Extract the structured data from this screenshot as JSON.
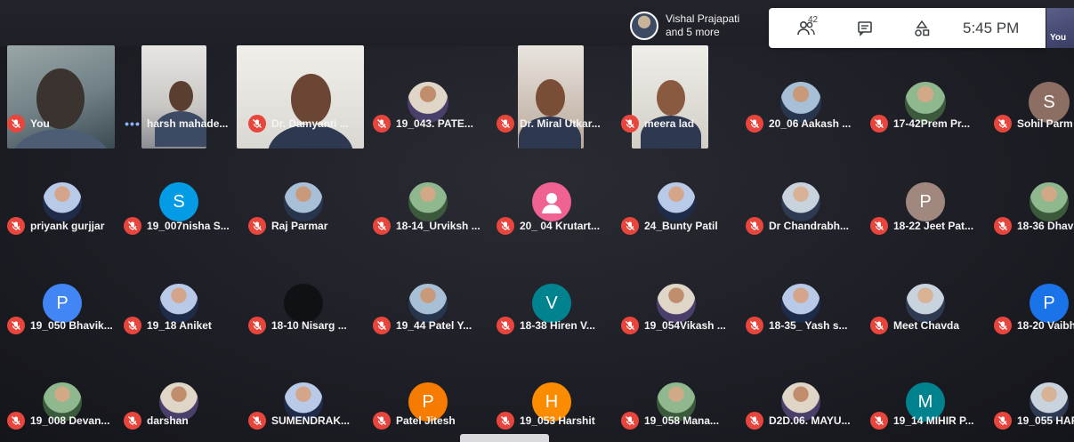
{
  "topbar": {
    "raised_hand": {
      "line1": "Vishal Prajapati",
      "line2": "and 5 more"
    },
    "people_count": "42",
    "time": "5:45 PM",
    "self_label": "You"
  },
  "colors": {
    "muted_mic": "#e8453c",
    "panel_bg": "#ffffff",
    "background": "#1f2027"
  },
  "grid": [
    [
      {
        "name": "You",
        "type": "video",
        "mic": "muted"
      },
      {
        "name": "harsh mahade...",
        "type": "video",
        "mic": "speaking"
      },
      {
        "name": "Dr. Damyanti ...",
        "type": "video",
        "mic": "muted"
      },
      {
        "name": "19_043. PATE...",
        "type": "photo",
        "mic": "muted"
      },
      {
        "name": "Dr. Miral Utkar...",
        "type": "video",
        "mic": "muted"
      },
      {
        "name": "meera lad",
        "type": "video",
        "mic": "muted"
      },
      {
        "name": "20_06 Aakash ...",
        "type": "photo",
        "mic": "muted"
      },
      {
        "name": "17-42Prem Pr...",
        "type": "photo",
        "mic": "muted"
      },
      {
        "name": "Sohil Parm",
        "type": "letter",
        "letter": "S",
        "color": "#8d6e63",
        "mic": "muted"
      }
    ],
    [
      {
        "name": "priyank gurjjar",
        "type": "photo",
        "mic": "muted"
      },
      {
        "name": "19_007nisha S...",
        "type": "letter",
        "letter": "S",
        "color": "#039be5",
        "mic": "muted"
      },
      {
        "name": "Raj Parmar",
        "type": "photo",
        "mic": "muted"
      },
      {
        "name": "18-14_Urviksh ...",
        "type": "photo",
        "mic": "muted"
      },
      {
        "name": "20_ 04 Krutart...",
        "type": "default",
        "mic": "muted"
      },
      {
        "name": "24_Bunty Patil",
        "type": "photo",
        "mic": "muted"
      },
      {
        "name": "Dr Chandrabh...",
        "type": "photo",
        "mic": "muted"
      },
      {
        "name": "18-22 Jeet Pat...",
        "type": "letter",
        "letter": "P",
        "color": "#a1887f",
        "mic": "muted"
      },
      {
        "name": "18-36 Dhav",
        "type": "photo",
        "mic": "muted"
      }
    ],
    [
      {
        "name": "19_050 Bhavik...",
        "type": "letter",
        "letter": "P",
        "color": "#4285f4",
        "mic": "muted"
      },
      {
        "name": "19_18 Aniket",
        "type": "photo",
        "mic": "muted"
      },
      {
        "name": "18-10 Nisarg ...",
        "type": "photo",
        "mic": "muted"
      },
      {
        "name": "19_44 Patel Y...",
        "type": "photo",
        "mic": "muted"
      },
      {
        "name": "18-38 Hiren V...",
        "type": "letter",
        "letter": "V",
        "color": "#00838f",
        "mic": "muted"
      },
      {
        "name": "19_054Vikash ...",
        "type": "photo",
        "mic": "muted"
      },
      {
        "name": "18-35_ Yash s...",
        "type": "photo",
        "mic": "muted"
      },
      {
        "name": "Meet Chavda",
        "type": "photo",
        "mic": "muted"
      },
      {
        "name": "18-20 Vaibh",
        "type": "letter",
        "letter": "P",
        "color": "#1a73e8",
        "mic": "muted"
      }
    ],
    [
      {
        "name": "19_008 Devan...",
        "type": "photo",
        "mic": "muted"
      },
      {
        "name": "darshan",
        "type": "photo",
        "mic": "muted"
      },
      {
        "name": "SUMENDRAK...",
        "type": "photo",
        "mic": "muted"
      },
      {
        "name": "Patel Jitesh",
        "type": "letter",
        "letter": "P",
        "color": "#f57c00",
        "mic": "muted"
      },
      {
        "name": "19_053 Harshit",
        "type": "letter",
        "letter": "H",
        "color": "#fb8c00",
        "mic": "muted"
      },
      {
        "name": "19_058 Mana...",
        "type": "photo",
        "mic": "muted"
      },
      {
        "name": "D2D.06. MAYU...",
        "type": "photo",
        "mic": "muted"
      },
      {
        "name": "19_14 MIHIR P...",
        "type": "letter",
        "letter": "M",
        "color": "#00838f",
        "mic": "muted"
      },
      {
        "name": "19_055 HAR",
        "type": "photo",
        "mic": "muted"
      }
    ]
  ]
}
